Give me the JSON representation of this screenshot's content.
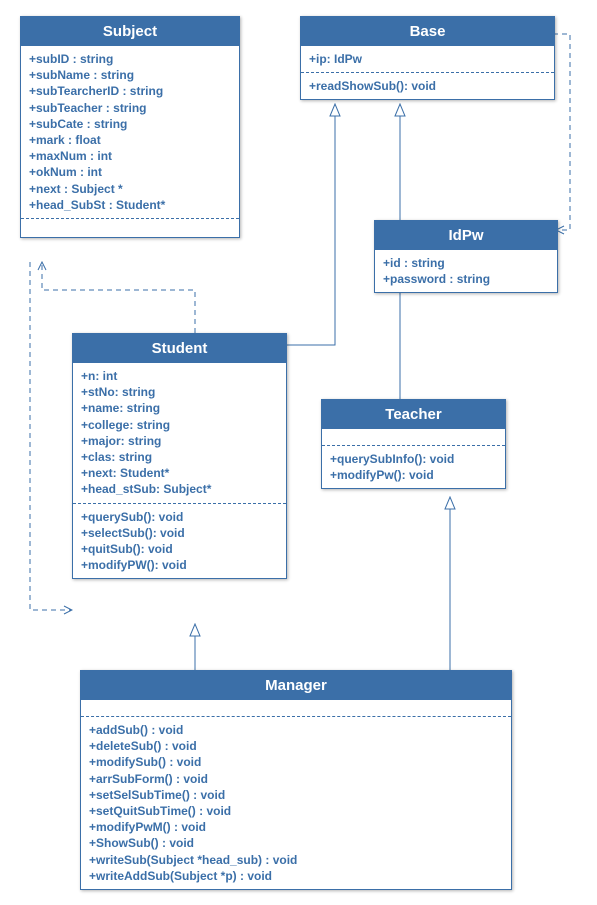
{
  "classes": {
    "subject": {
      "title": "Subject",
      "attrs": [
        "+subID : string",
        "+subName : string",
        "+subTearcherID : string",
        "+subTeacher : string",
        "+subCate : string",
        "+mark : float",
        "+maxNum : int",
        "+okNum : int",
        "+next : Subject *",
        "+head_SubSt : Student*"
      ]
    },
    "base": {
      "title": "Base",
      "attrs": [
        "+ip: IdPw"
      ],
      "methods": [
        "+readShowSub(): void"
      ]
    },
    "idpw": {
      "title": "IdPw",
      "attrs": [
        "+id : string",
        "+password : string"
      ]
    },
    "student": {
      "title": "Student",
      "attrs": [
        "+n: int",
        "+stNo: string",
        "+name: string",
        "+college: string",
        "+major: string",
        "+clas: string",
        "+next: Student*",
        "+head_stSub: Subject*"
      ],
      "methods": [
        "+querySub(): void",
        "+selectSub(): void",
        "+quitSub(): void",
        "+modifyPW(): void"
      ]
    },
    "teacher": {
      "title": "Teacher",
      "methods": [
        "+querySubInfo(): void",
        "+modifyPw(): void"
      ]
    },
    "manager": {
      "title": "Manager",
      "methods": [
        "+addSub() : void",
        "+deleteSub() : void",
        "+modifySub() : void",
        "+arrSubForm() : void",
        "+setSelSubTime() : void",
        "+setQuitSubTime() : void",
        "+modifyPwM() : void",
        "+ShowSub() : void",
        "+writeSub(Subject *head_sub) : void",
        "+writeAddSub(Subject *p) : void"
      ]
    }
  }
}
